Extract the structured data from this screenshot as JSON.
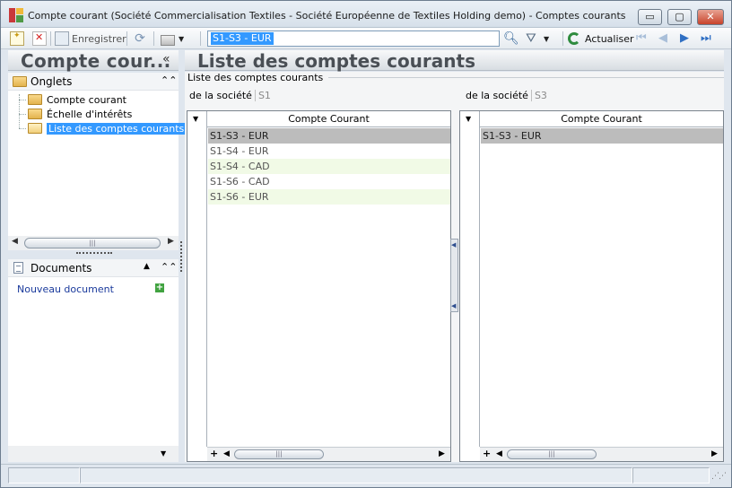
{
  "window": {
    "title": "Compte courant (Société Commercialisation Textiles - Société Européenne de Textiles Holding demo) -  Comptes courants",
    "buttons": {
      "minimize": "▭",
      "maximize": "▢",
      "close": "✕"
    }
  },
  "toolbar": {
    "save_label": "Enregistrer",
    "search_value": "S1-S3 - EUR",
    "actualiser_label": "Actualiser",
    "icons": [
      "new-icon",
      "delete-icon",
      "save-icon",
      "refresh-icon",
      "print-icon",
      "search-icon",
      "filter-icon",
      "actualiser-icon",
      "first-icon",
      "prev-icon",
      "next-icon",
      "last-icon"
    ]
  },
  "left_panel": {
    "title": "Compte cour...",
    "collapse_glyph": "«",
    "onglets": {
      "label": "Onglets",
      "items": [
        {
          "label": "Compte courant",
          "selected": false
        },
        {
          "label": "Échelle d'intérêts",
          "selected": false
        },
        {
          "label": "Liste des comptes courants",
          "selected": true
        }
      ]
    },
    "documents": {
      "label": "Documents",
      "new_document": "Nouveau document"
    }
  },
  "main": {
    "title": "Liste des comptes courants",
    "group_title": "Liste des comptes courants",
    "left_grid": {
      "societe_label": "de la société",
      "societe_value": "S1",
      "column_header": "Compte Courant",
      "rows": [
        "S1-S3 - EUR",
        "S1-S4 - EUR",
        "S1-S4 - CAD",
        "S1-S6 - CAD",
        "S1-S6 - EUR"
      ],
      "selected_index": 0
    },
    "right_grid": {
      "societe_label": "de la société",
      "societe_value": "S3",
      "column_header": "Compte Courant",
      "rows": [
        "S1-S3 - EUR"
      ],
      "selected_index": 0
    }
  },
  "colors": {
    "selection_blue": "#3399ff",
    "row_selected": "#bcbcbc",
    "row_alt": "#f1fae6",
    "link": "#1a3a9c"
  }
}
